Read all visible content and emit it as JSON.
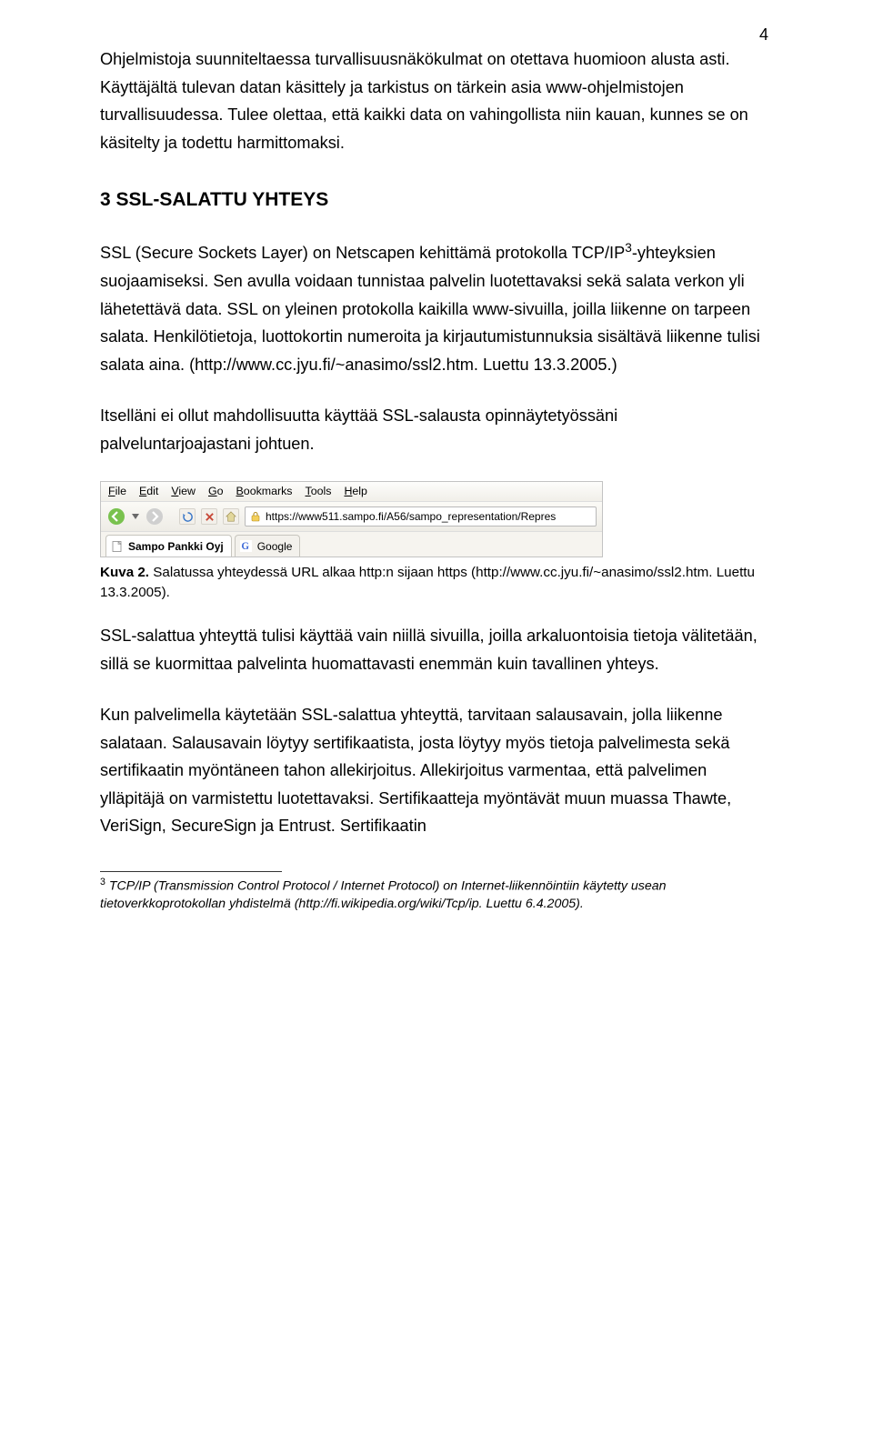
{
  "page_number": "4",
  "para1": "Ohjelmistoja suunniteltaessa turvallisuusnäkökulmat on otettava huomioon alusta asti. Käyttäjältä tulevan datan käsittely ja tarkistus on tärkein asia www-ohjelmistojen turvallisuudessa. Tulee olettaa, että kaikki data on vahingollista niin kauan, kunnes se on käsitelty ja todettu harmittomaksi.",
  "heading": "3 SSL-SALATTU YHTEYS",
  "para2_a": "SSL (Secure Sockets Layer) on Netscapen kehittämä protokolla TCP/IP",
  "para2_sup": "3",
  "para2_b": "-yhteyksien suojaamiseksi. Sen avulla voidaan tunnistaa palvelin luotettavaksi sekä salata verkon yli lähetettävä data. SSL on yleinen protokolla kaikilla www-sivuilla, joilla liikenne on tarpeen salata. Henkilötietoja, luottokortin numeroita ja kirjautumistunnuksia sisältävä liikenne tulisi salata aina. (http://www.cc.jyu.fi/~anasimo/ssl2.htm. Luettu 13.3.2005.)",
  "para3": "Itselläni ei ollut mahdollisuutta käyttää SSL-salausta opinnäytetyössäni palveluntarjoajastani johtuen.",
  "browser": {
    "menu": {
      "file": "File",
      "edit": "Edit",
      "view": "View",
      "go": "Go",
      "bookmarks": "Bookmarks",
      "tools": "Tools",
      "help": "Help"
    },
    "url": "https://www511.sampo.fi/A56/sampo_representation/Repres",
    "tab1": "Sampo Pankki Oyj",
    "tab2": "Google"
  },
  "caption": "Kuva 2. Salatussa yhteydessä URL alkaa http:n sijaan https (http://www.cc.jyu.fi/~anasimo/ssl2.htm. Luettu 13.3.2005).",
  "para4": "SSL-salattua yhteyttä tulisi käyttää vain niillä sivuilla, joilla arkaluontoisia tietoja välitetään, sillä se kuormittaa palvelinta huomattavasti enemmän kuin tavallinen yhteys.",
  "para5": "Kun palvelimella käytetään SSL-salattua yhteyttä, tarvitaan salausavain, jolla liikenne salataan. Salausavain löytyy sertifikaatista, josta löytyy myös tietoja palvelimesta sekä sertifikaatin myöntäneen tahon allekirjoitus. Allekirjoitus varmentaa, että palvelimen ylläpitäjä on varmistettu luotettavaksi. Sertifikaatteja myöntävät muun muassa Thawte, VeriSign, SecureSign ja Entrust. Sertifikaatin",
  "footnote_sup": "3",
  "footnote": " TCP/IP (Transmission Control Protocol / Internet Protocol) on Internet-liikennöintiin käytetty usean tietoverkkoprotokollan yhdistelmä (http://fi.wikipedia.org/wiki/Tcp/ip. Luettu 6.4.2005)."
}
